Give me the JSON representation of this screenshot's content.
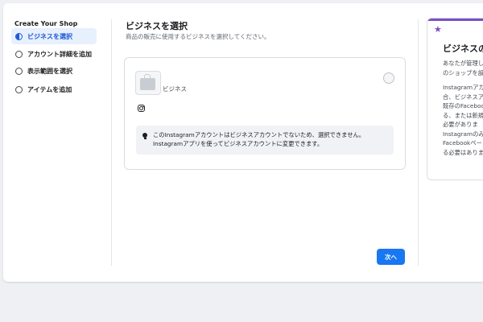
{
  "sidebar": {
    "title": "Create Your Shop",
    "steps": [
      {
        "label": "ビジネスを選択",
        "active": true
      },
      {
        "label": "アカウント詳細を追加",
        "active": false
      },
      {
        "label": "表示範囲を選択",
        "active": false
      },
      {
        "label": "アイテムを追加",
        "active": false
      }
    ]
  },
  "main": {
    "title": "ビジネスを選択",
    "subtitle": "商品の販売に使用するビジネスを選択してください。",
    "business_card": {
      "name": "ビジネス",
      "notice_lines": [
        "このInstagramアカウントはビジネスアカウントでないため、選択できません。",
        "Instagramアプリを使ってビジネスアカウントに変更できます。"
      ]
    },
    "next_label": "次へ"
  },
  "info_panel": {
    "title": "ビジネスの",
    "para1_lines": [
      "あなたが管理し",
      "のショップを設"
    ],
    "para2_lines": [
      "Instagramアカ",
      "合、ビジネスア",
      "既存のFaceboo",
      "る、または新規",
      "必要がありま",
      "Instagramのみ",
      "Facebookペー",
      "る必要はありま"
    ]
  },
  "colors": {
    "accent": "#1877f2",
    "active_step_bg": "#e7f0fd",
    "panel_accent": "#7b4fc9"
  }
}
